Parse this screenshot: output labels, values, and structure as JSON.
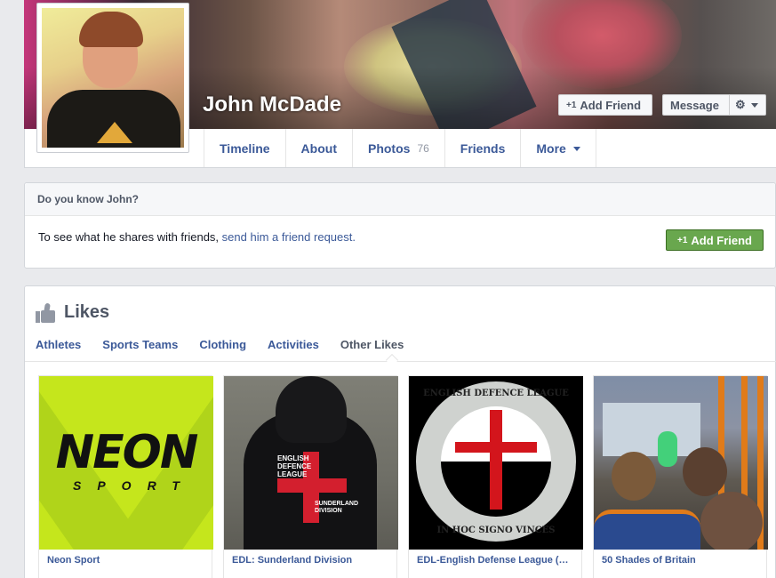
{
  "profile": {
    "name": "John McDade",
    "add_friend_label": "Add Friend",
    "message_label": "Message",
    "plus_glyph": "+1"
  },
  "nav": {
    "tabs": [
      {
        "label": "Timeline"
      },
      {
        "label": "About"
      },
      {
        "label": "Photos",
        "count": "76"
      },
      {
        "label": "Friends"
      },
      {
        "label": "More"
      }
    ]
  },
  "know": {
    "heading": "Do you know John?",
    "text": "To see what he shares with friends, ",
    "link": "send him a friend request.",
    "button_label": "Add Friend"
  },
  "likes": {
    "title": "Likes",
    "categories": [
      "Athletes",
      "Sports Teams",
      "Clothing",
      "Activities",
      "Other Likes"
    ],
    "active_category": "Other Likes",
    "items": [
      {
        "label": "Neon Sport",
        "image_text": "NEON",
        "image_sub": "SPORT"
      },
      {
        "label": "EDL: Sunderland Division",
        "image_text": "ENGLISH DEFENCE LEAGUE",
        "image_sub": "SUNDERLAND DIVISION"
      },
      {
        "label": "EDL-English Defense League (Official)",
        "image_text": "ENGLISH DEFENCE LEAGUE",
        "image_sub": "IN HOC SIGNO VINCES"
      },
      {
        "label": "50 Shades of Britain"
      }
    ]
  },
  "colors": {
    "link": "#3b5998",
    "green_button": "#69a74e",
    "page_bg": "#e9eaed"
  },
  "icons": {
    "gear": "gear-icon",
    "likes": "thumbs-up-icon",
    "more_caret": "chevron-down-icon"
  }
}
